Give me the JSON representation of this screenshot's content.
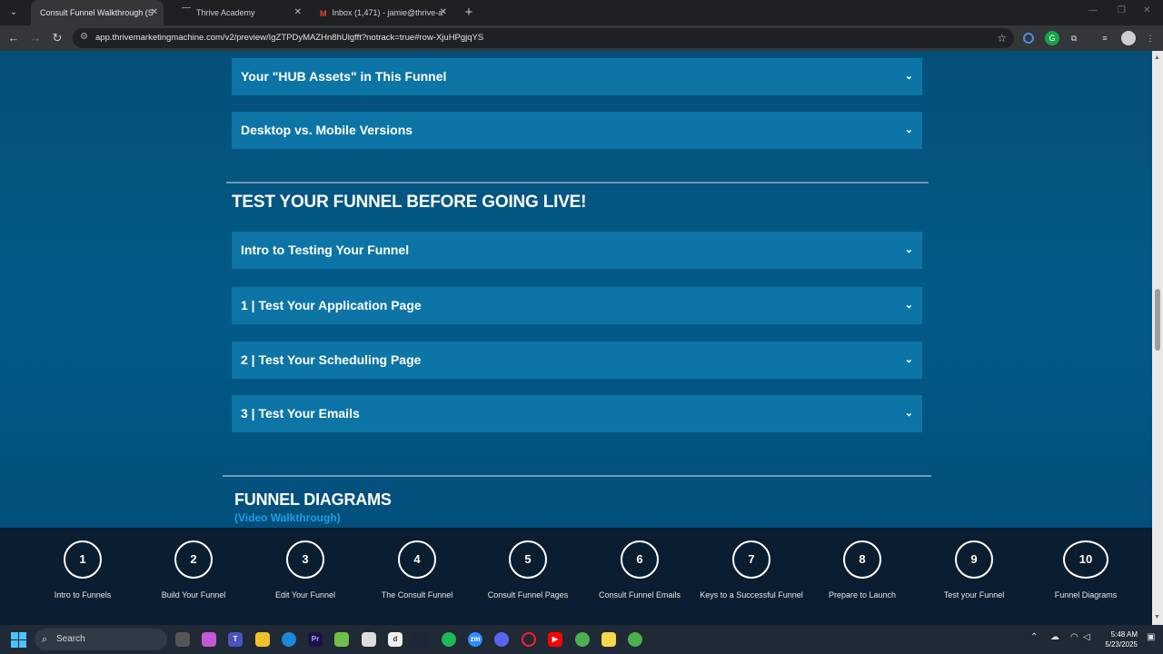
{
  "browser": {
    "tabs": [
      {
        "title": "Consult Funnel Walkthrough (S",
        "active": true
      },
      {
        "title": "Thrive Academy",
        "active": false
      },
      {
        "title": "Inbox (1,471) - jamie@thrive-a",
        "active": false
      }
    ],
    "url": "app.thrivemarketingmachine.com/v2/preview/IgZTPDyMAZHn8hUlgfft?notrack=true#row-XjuHPgjqYS"
  },
  "page": {
    "accordions_top": [
      {
        "label": "Your \"HUB Assets\" in This Funnel"
      },
      {
        "label": "Desktop vs. Mobile Versions"
      }
    ],
    "test_section_title": "TEST YOUR FUNNEL BEFORE GOING LIVE!",
    "accordions_test": [
      {
        "label": "Intro to Testing Your Funnel"
      },
      {
        "label": "1 | Test Your Application Page"
      },
      {
        "label": "2 | Test Your Scheduling Page"
      },
      {
        "label": "3 | Test Your Emails"
      }
    ],
    "diagrams_title": "FUNNEL DIAGRAMS",
    "diagrams_subtitle": "(Video Walkthrough)"
  },
  "step_nav": [
    {
      "num": "1",
      "label": "Intro to Funnels"
    },
    {
      "num": "2",
      "label": "Build Your Funnel"
    },
    {
      "num": "3",
      "label": "Edit Your Funnel"
    },
    {
      "num": "4",
      "label": "The Consult Funnel"
    },
    {
      "num": "5",
      "label": "Consult Funnel Pages"
    },
    {
      "num": "6",
      "label": "Consult Funnel Emails"
    },
    {
      "num": "7",
      "label": "Keys to a Successful Funnel"
    },
    {
      "num": "8",
      "label": "Prepare to Launch"
    },
    {
      "num": "9",
      "label": "Test your Funnel"
    },
    {
      "num": "10",
      "label": "Funnel Diagrams"
    }
  ],
  "taskbar": {
    "search_placeholder": "Search",
    "time": "5:48 AM",
    "date": "5/23/2025"
  },
  "colors": {
    "page_bg": "#035079",
    "accordion_bg": "#0d75a6",
    "subtitle_link": "#1e9ee6",
    "step_nav_bg": "#0a1d31"
  }
}
